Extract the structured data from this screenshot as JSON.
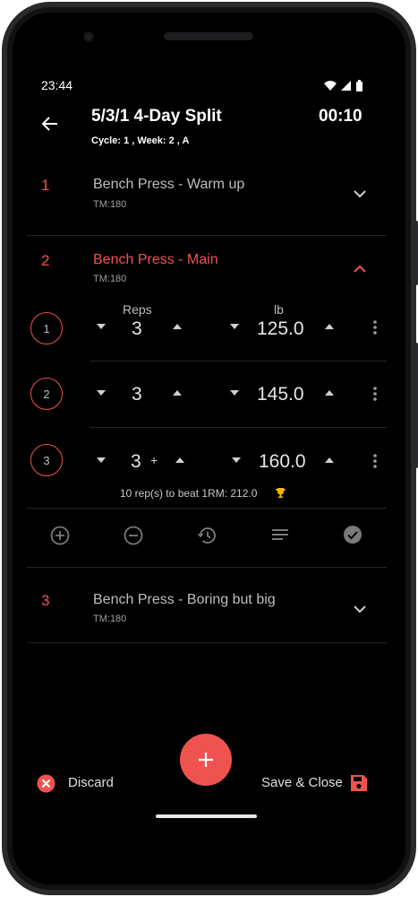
{
  "status_bar": {
    "time": "23:44"
  },
  "header": {
    "title": "5/3/1 4-Day Split",
    "subtitle": "Cycle: 1 , Week: 2 , A",
    "timer": "00:10"
  },
  "colors": {
    "accent": "#ef5350",
    "background": "#000000",
    "text": "#e0e0e0",
    "muted": "#9e9e9e"
  },
  "exercises": [
    {
      "index": "1",
      "name": "Bench Press - Warm up",
      "tm": "TM:180"
    },
    {
      "index": "2",
      "name": "Bench Press - Main",
      "tm": "TM:180"
    },
    {
      "index": "3",
      "name": "Bench Press - Boring but big",
      "tm": "TM:180"
    }
  ],
  "set_headers": {
    "reps": "Reps",
    "unit": "lb"
  },
  "sets": [
    {
      "number": "1",
      "reps": "3",
      "weight": "125.0"
    },
    {
      "number": "2",
      "reps": "3",
      "weight": "145.0"
    },
    {
      "number": "3",
      "reps": "3",
      "amrap": "+",
      "weight": "160.0"
    }
  ],
  "beat_message": "10 rep(s) to beat 1RM: 212.0",
  "bottom": {
    "discard": "Discard",
    "save": "Save & Close"
  }
}
